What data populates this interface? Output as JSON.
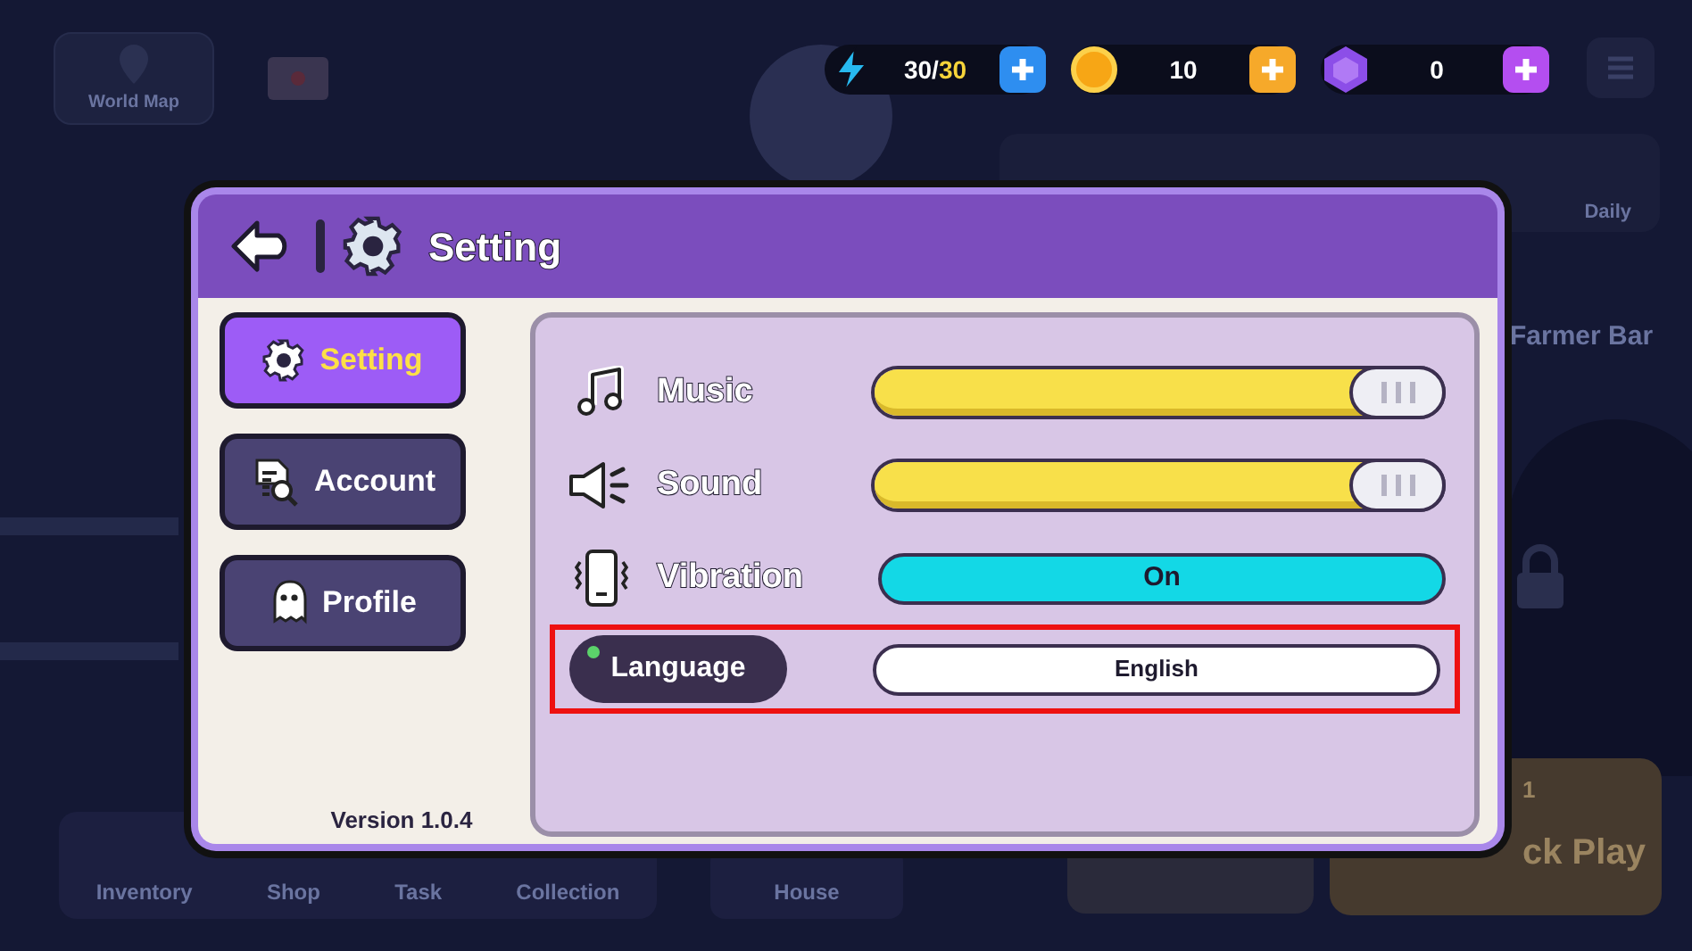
{
  "background": {
    "map_button": "World Map",
    "daily_label": "Daily",
    "area_title": "Farmer Bar",
    "nav_items": [
      "Inventory",
      "Shop",
      "Task",
      "Collection"
    ],
    "house_label": "House",
    "play_count": "1",
    "play_label": "ck Play"
  },
  "hud": {
    "energy": {
      "current": "30/",
      "max": "30"
    },
    "coins": "10",
    "gems": "0"
  },
  "dialog": {
    "title": "Setting",
    "tabs": [
      {
        "label": "Setting",
        "kind": "gear",
        "selected": true
      },
      {
        "label": "Account",
        "kind": "document",
        "selected": false
      },
      {
        "label": "Profile",
        "kind": "ghost",
        "selected": false
      }
    ],
    "version": "Version 1.0.4",
    "rows": [
      {
        "kind": "slider",
        "label": "Music",
        "level": 1
      },
      {
        "kind": "slider",
        "label": "Sound",
        "level": 1
      },
      {
        "kind": "toggle",
        "label": "Vibration",
        "on": true,
        "value": "On"
      },
      {
        "kind": "select",
        "label": "Language",
        "value": "English",
        "highlighted": true
      }
    ]
  }
}
